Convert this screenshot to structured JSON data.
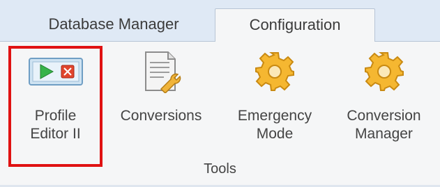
{
  "tabs": [
    {
      "label": "Database Manager",
      "active": false
    },
    {
      "label": "Configuration",
      "active": true
    }
  ],
  "tools": [
    {
      "icon": "profile-editor-icon",
      "line1": "Profile",
      "line2": "Editor II",
      "highlighted": true
    },
    {
      "icon": "conversions-document-icon",
      "line1": "Conversions",
      "line2": ""
    },
    {
      "icon": "gear-icon",
      "line1": "Emergency",
      "line2": "Mode"
    },
    {
      "icon": "gear-icon",
      "line1": "Conversion",
      "line2": "Manager"
    }
  ],
  "group": {
    "label": "Tools"
  },
  "colors": {
    "tabbar_bg": "#dfe9f5",
    "ribbon_bg": "#f5f6f7",
    "highlight": "#e01212",
    "gear": "#f5b731",
    "play": "#37b34a",
    "stop": "#e0452d"
  }
}
